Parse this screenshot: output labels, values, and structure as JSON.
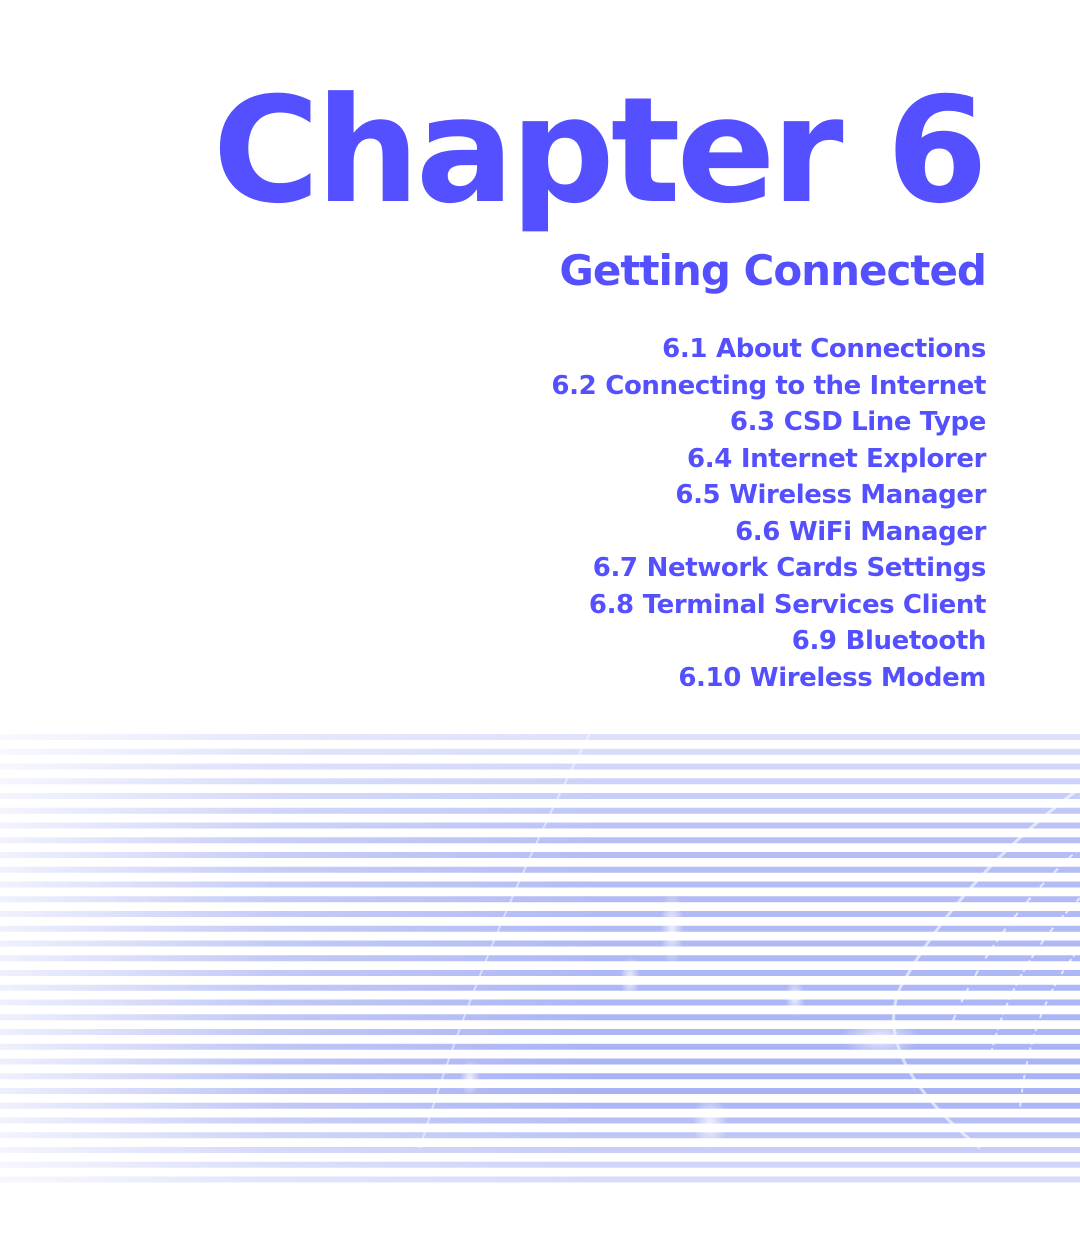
{
  "colors": {
    "accent": "#5450ff",
    "stripe": "#a8b2f4",
    "stripe_light": "#e4e8fd"
  },
  "chapter": {
    "title": "Chapter 6",
    "subtitle": "Getting Connected"
  },
  "toc": [
    {
      "number": "6.1",
      "label": "About Connections"
    },
    {
      "number": "6.2",
      "label": "Connecting to the Internet"
    },
    {
      "number": "6.3",
      "label": "CSD Line Type"
    },
    {
      "number": "6.4",
      "label": "Internet Explorer"
    },
    {
      "number": "6.5",
      "label": "Wireless Manager"
    },
    {
      "number": "6.6",
      "label": "WiFi Manager"
    },
    {
      "number": "6.7",
      "label": "Network Cards Settings"
    },
    {
      "number": "6.8",
      "label": "Terminal Services Client"
    },
    {
      "number": "6.9",
      "label": "Bluetooth"
    },
    {
      "number": "6.10",
      "label": "Wireless Modem"
    }
  ],
  "decoration": {
    "name": "striped-globe-banner"
  }
}
